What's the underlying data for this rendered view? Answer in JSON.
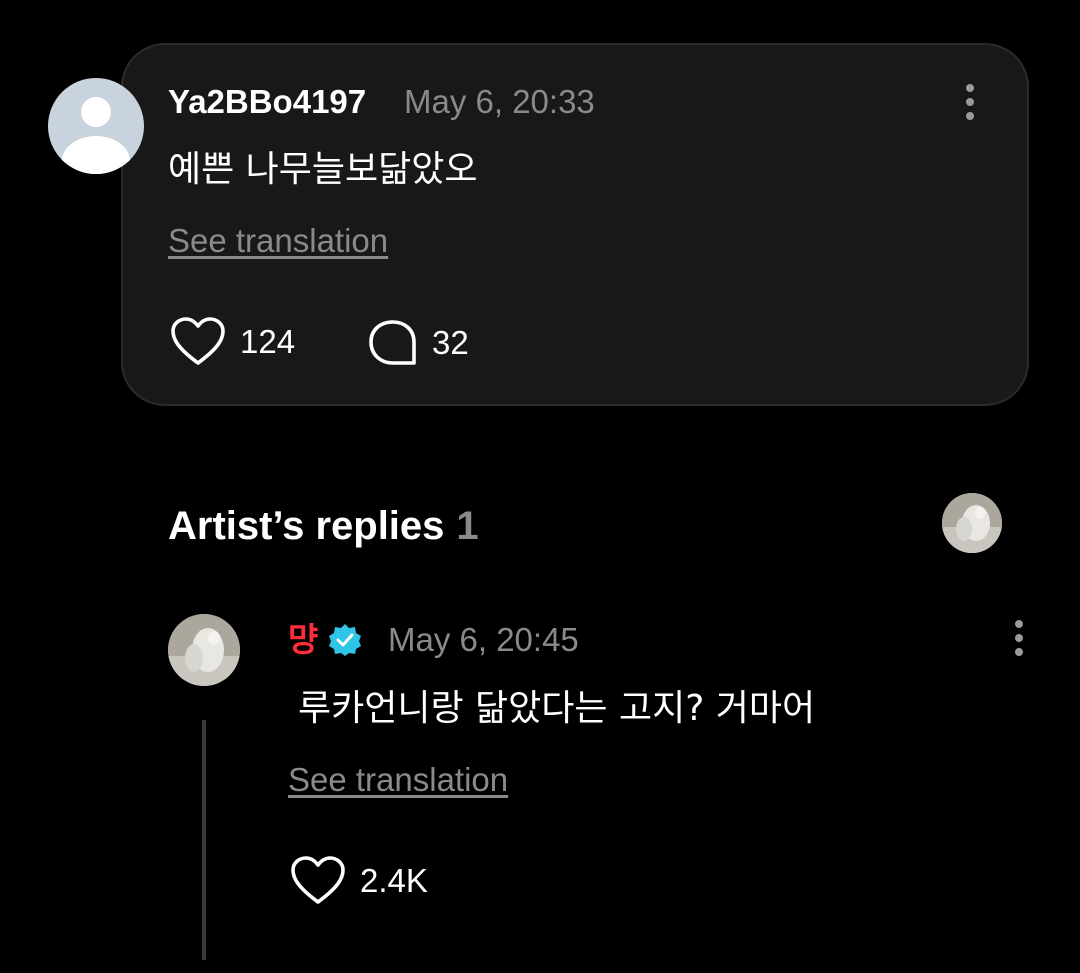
{
  "comment": {
    "username": "Ya2BBo4197",
    "timestamp": "May 6, 20:33",
    "text": "예쁜 나무늘보닮았오",
    "see_translation": "See translation",
    "like_count": "124",
    "reply_count": "32"
  },
  "artist_replies": {
    "title": "Artist’s replies",
    "count": "1",
    "reply": {
      "username": "먕",
      "timestamp": "May 6, 20:45",
      "text": "루카언니랑 닮았다는 고지? 거마어",
      "see_translation": "See translation",
      "like_count": "2.4K"
    }
  },
  "colors": {
    "background": "#000000",
    "card": "#181818",
    "muted_text": "#8a8a8a",
    "artist_name": "#ff2d3a",
    "verified_badge": "#2ec5e8"
  },
  "icons": {
    "like": "heart-outline-icon",
    "reply": "speech-bubble-icon",
    "more": "more-vertical-icon",
    "verified": "verified-badge-icon"
  }
}
